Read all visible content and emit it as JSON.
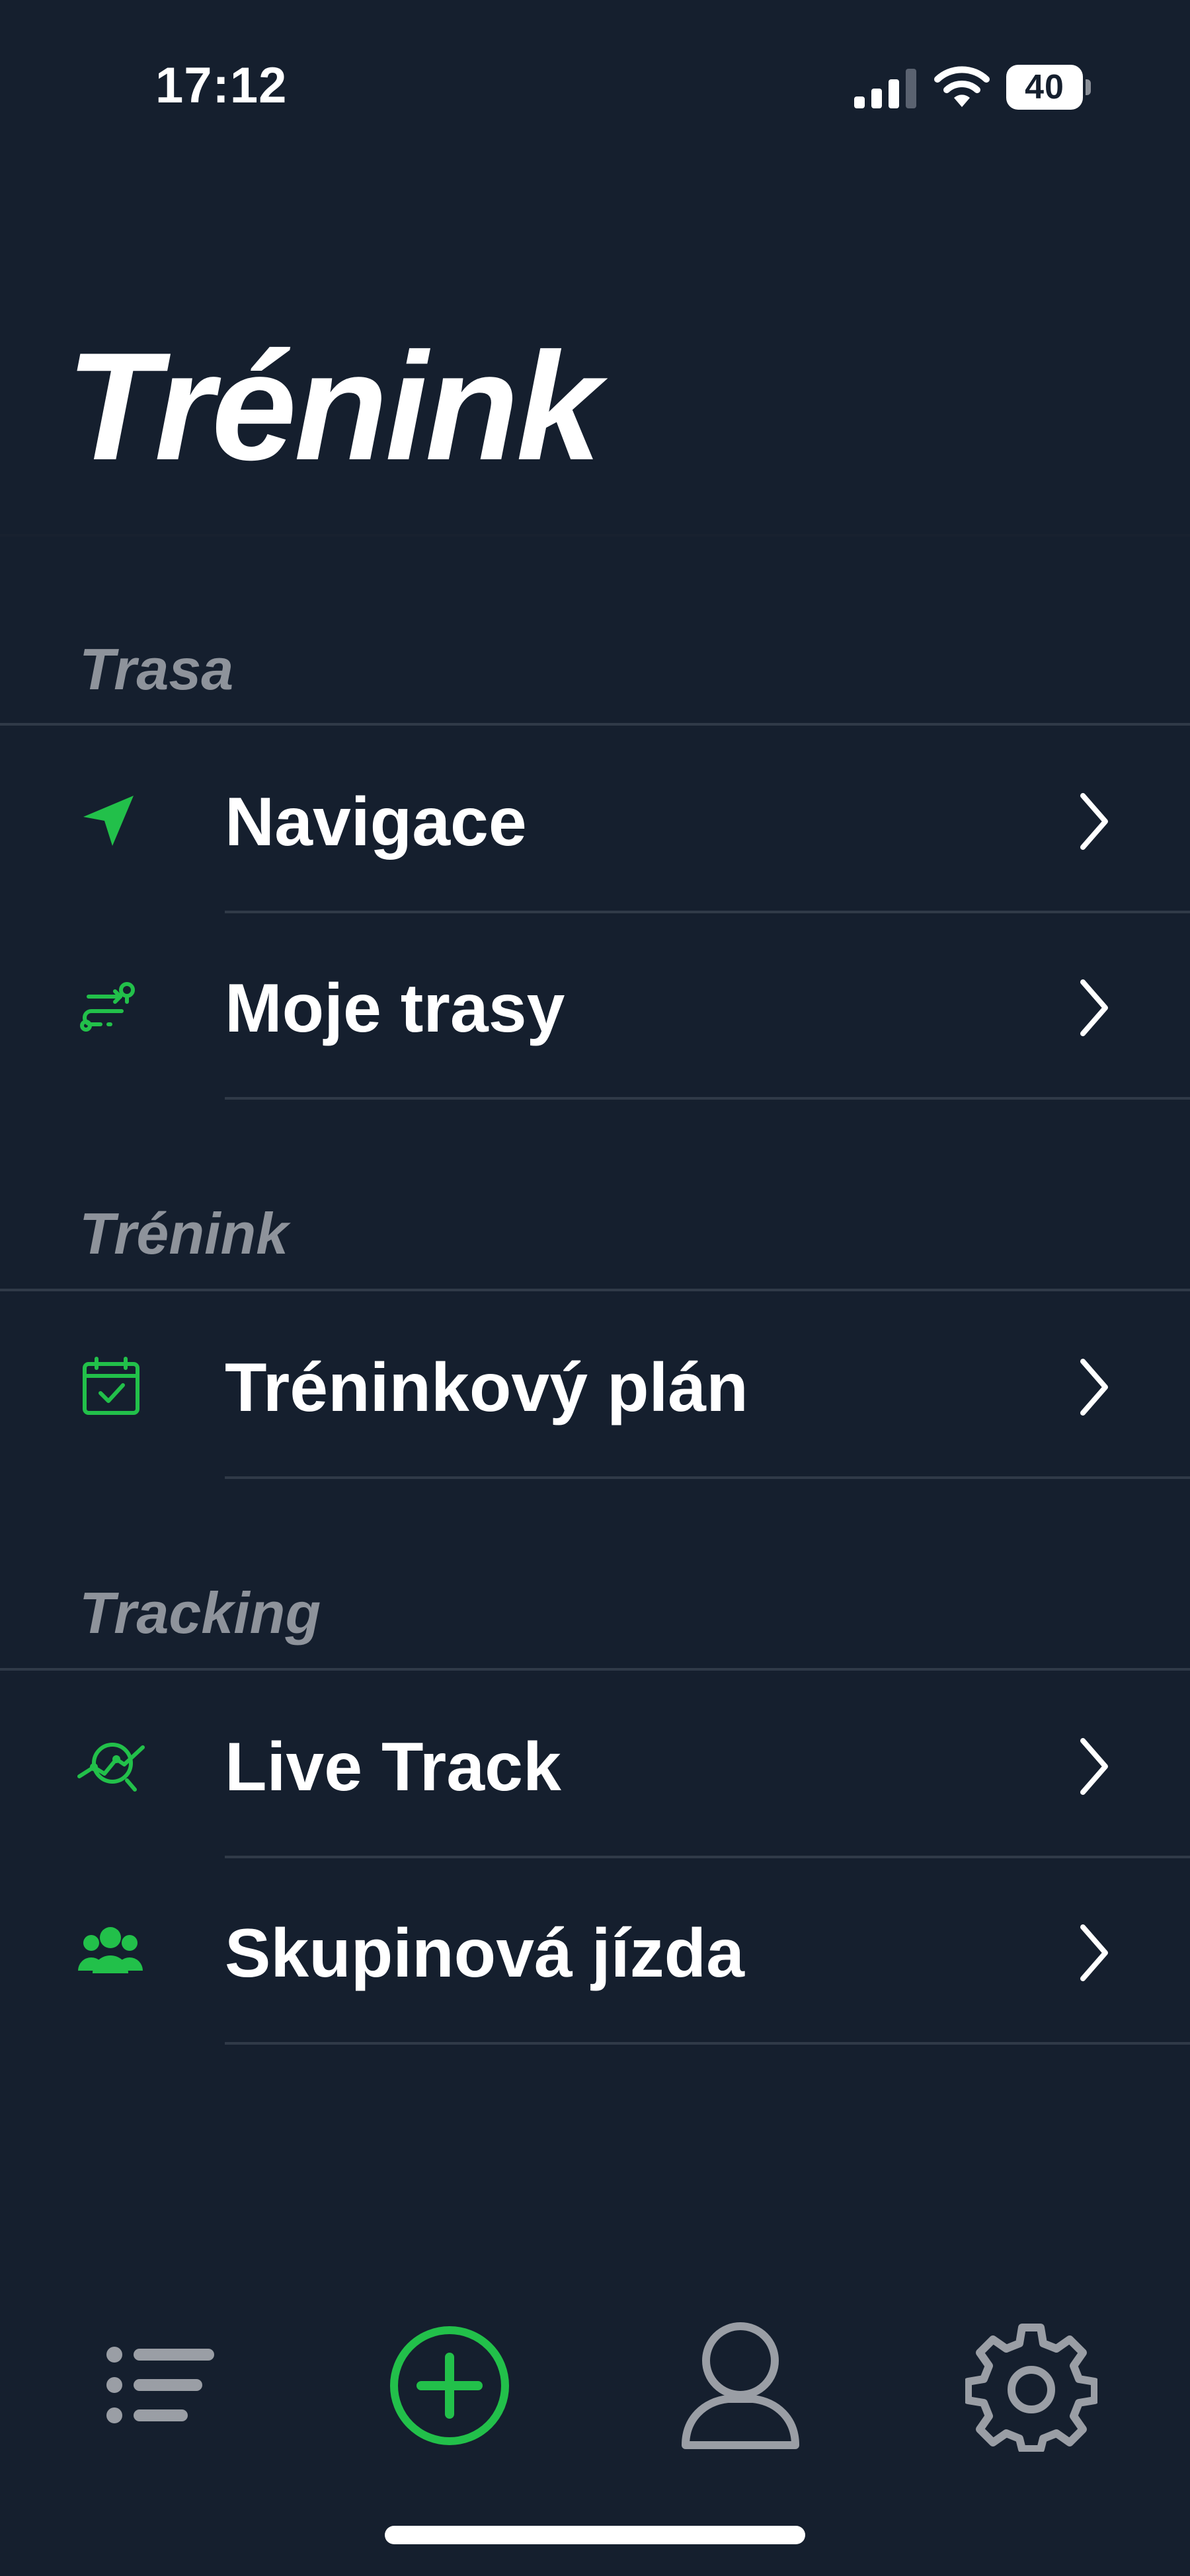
{
  "status_bar": {
    "time": "17:12",
    "battery_level": "40",
    "icons": [
      "cellular-signal-icon",
      "wifi-icon",
      "battery-icon"
    ]
  },
  "header": {
    "title": "Trénink"
  },
  "sections": [
    {
      "title": "Trasa",
      "items": [
        {
          "label": "Navigace",
          "icon": "navigation-arrow-icon"
        },
        {
          "label": "Moje trasy",
          "icon": "route-icon"
        }
      ]
    },
    {
      "title": "Trénink",
      "items": [
        {
          "label": "Tréninkový plán",
          "icon": "calendar-check-icon"
        }
      ]
    },
    {
      "title": "Tracking",
      "items": [
        {
          "label": "Live Track",
          "icon": "live-track-icon"
        },
        {
          "label": "Skupinová jízda",
          "icon": "group-ride-icon"
        }
      ]
    }
  ],
  "tab_bar": {
    "items": [
      {
        "icon": "list-icon",
        "selected": false
      },
      {
        "icon": "add-circle-icon",
        "selected": true
      },
      {
        "icon": "profile-icon",
        "selected": false
      },
      {
        "icon": "gear-icon",
        "selected": false
      }
    ]
  },
  "colors": {
    "background": "#151F2E",
    "accent": "#22C04A",
    "section_header": "#8E939B",
    "separator": "#303A48",
    "inactive_tab": "#9A9EA5"
  }
}
